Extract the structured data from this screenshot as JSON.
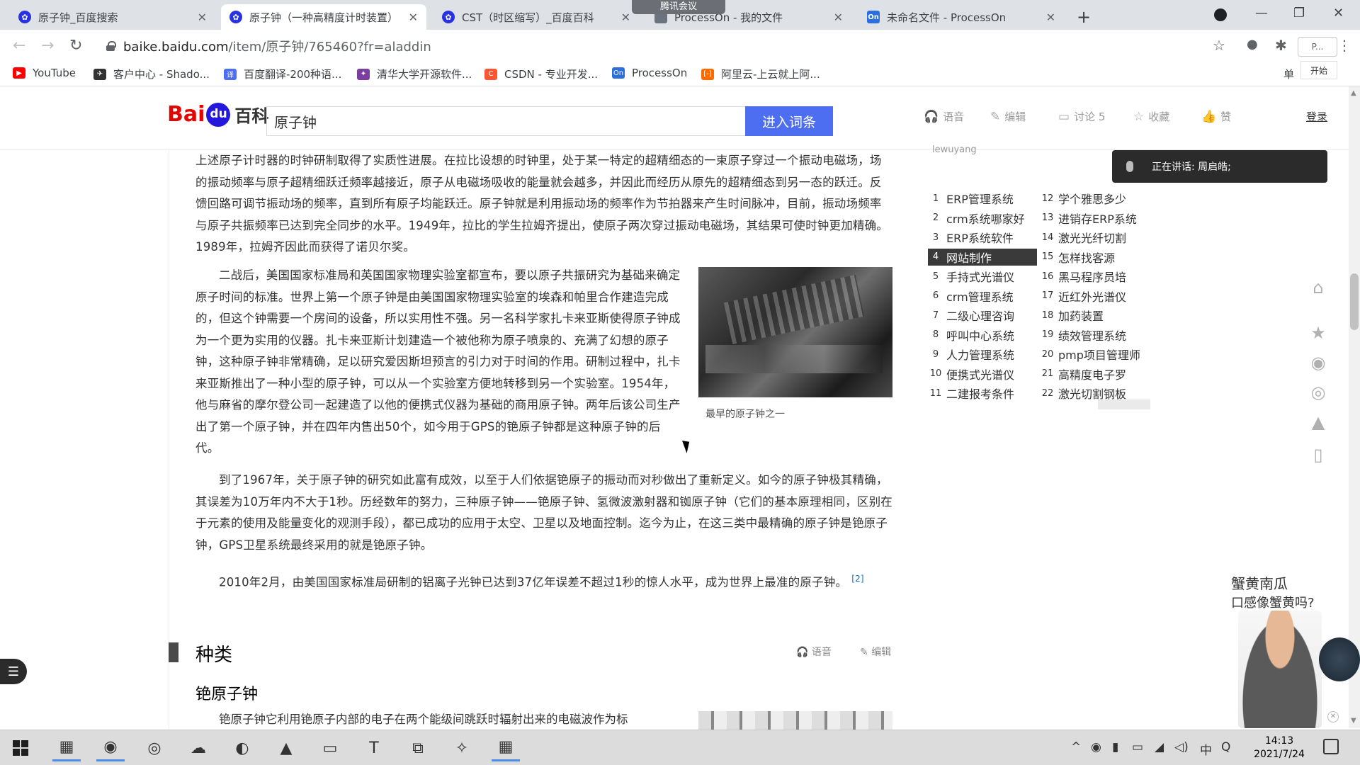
{
  "browser": {
    "tabs": [
      {
        "title": "原子钟_百度搜索",
        "icon": "paw"
      },
      {
        "title": "原子钟（一种高精度计时装置）",
        "icon": "paw"
      },
      {
        "title": "CST（时区缩写）_百度百科",
        "icon": "paw"
      },
      {
        "title": "ProcessOn - 我的文件",
        "icon": "doc"
      },
      {
        "title": "未命名文件 - ProcessOn",
        "icon": "on"
      }
    ],
    "meeting_pill": "腾讯会议",
    "url": {
      "host": "baike.baidu.com",
      "path": "/item/原子钟/765460?fr=aladdin"
    },
    "profile_chip": "P...",
    "kaishi": "开始",
    "bookmarks": [
      {
        "label": "YouTube",
        "color": "#ff0000"
      },
      {
        "label": "客户中心 - Shado...",
        "color": "#333333"
      },
      {
        "label": "百度翻译-200种语...",
        "color": "#4e6ef2"
      },
      {
        "label": "清华大学开源软件...",
        "color": "#7b3fa0"
      },
      {
        "label": "CSDN - 专业开发...",
        "color": "#fc5531"
      },
      {
        "label": "ProcessOn",
        "color": "#2a6fdb"
      },
      {
        "label": "阿里云-上云就上阿...",
        "color": "#ff6a00"
      }
    ],
    "readlist": "单"
  },
  "header": {
    "logo_bai": "Bai",
    "logo_baike": "百科",
    "search_value": "原子钟",
    "search_button": "进入词条",
    "actions": [
      {
        "icon": "headphone-icon",
        "glyph": "🎧",
        "label": "语音"
      },
      {
        "icon": "pencil-icon",
        "glyph": "✎",
        "label": "编辑"
      },
      {
        "icon": "comment-icon",
        "glyph": "▭",
        "label": "讨论 5"
      },
      {
        "icon": "star-icon",
        "glyph": "☆",
        "label": "收藏"
      },
      {
        "icon": "thumb-icon",
        "glyph": "👍",
        "label": "赞"
      }
    ],
    "login": "登录"
  },
  "article": {
    "p1": "上述原子计时器的时钟研制取得了实质性进展。在拉比设想的时钟里，处于某一特定的超精细态的一束原子穿过一个振动电磁场，场的振动频率与原子超精细跃迁频率越接近，原子从电磁场吸收的能量就会越多，并因此而经历从原先的超精细态到另一态的跃迁。反馈回路可调节振动场的频率，直到所有原子均能跃迁。原子钟就是利用振动场的频率作为节拍器来产生时间脉冲，目前，振动场频率与原子共振频率已达到完全同步的水平。1949年，拉比的学生拉姆齐提出，使原子两次穿过振动电磁场，其结果可使时钟更加精确。1989年，拉姆齐因此而获得了诺贝尔奖。",
    "p2": "二战后，美国国家标准局和英国国家物理实验室都宣布，要以原子共振研究为基础来确定原子时间的标准。世界上第一个原子钟是由美国国家物理实验室的埃森和帕里合作建造完成的，但这个钟需要一个房间的设备，所以实用性不强。另一名科学家扎卡来亚斯使得原子钟成为一个更为实用的仪器。扎卡来亚斯计划建造一个被他称为原子喷泉的、充满了幻想的原子钟，这种原子钟非常精确，足以研究爱因斯坦预言的引力对于时间的作用。研制过程中，扎卡来亚斯推出了一种小型的原子钟，可以从一个实验室方便地转移到另一个实验室。1954年，他与麻省的摩尔登公司一起建造了以他的便携式仪器为基础的商用原子钟。两年后该公司生产出了第一个原子钟，并在四年内售出50个，如今用于GPS的铯原子钟都是这种原子钟的后代。",
    "figure1_caption": "最早的原子钟之一",
    "p3": "到了1967年，关于原子钟的研究如此富有成效，以至于人们依据铯原子的振动而对秒做出了重新定义。如今的原子钟极其精确，其误差为10万年内不大于1秒。历经数年的努力，三种原子钟——铯原子钟、氢微波激射器和铷原子钟（它们的基本原理相同，区别在于元素的使用及能量变化的观测手段），都已成功的应用于太空、卫星以及地面控制。迄今为止，在这三类中最精确的原子钟是铯原子钟，GPS卫星系统最终采用的就是铯原子钟。",
    "p4": "2010年2月，由美国国家标准局研制的铝离子光钟已达到37亿年误差不超过1秒的惊人水平，成为世界上最准的原子钟。",
    "p4_ref": "[2]",
    "section_title": "种类",
    "section_actions": [
      "语音",
      "编辑"
    ],
    "subsection_title": "铯原子钟",
    "p5": "铯原子钟它利用铯原子内部的电子在两个能级间跳跃时辐射出来的电磁波作为标"
  },
  "sidebar": {
    "top_text": "lewuyang",
    "speaking": "正在讲话: 周启皓;",
    "rank_left": [
      {
        "n": "1",
        "t": "ERP管理系统"
      },
      {
        "n": "2",
        "t": "crm系统哪家好"
      },
      {
        "n": "3",
        "t": "ERP系统软件"
      },
      {
        "n": "4",
        "t": "网站制作"
      },
      {
        "n": "5",
        "t": "手持式光谱仪"
      },
      {
        "n": "6",
        "t": "crm管理系统"
      },
      {
        "n": "7",
        "t": "二级心理咨询"
      },
      {
        "n": "8",
        "t": "呼叫中心系统"
      },
      {
        "n": "9",
        "t": "人力管理系统"
      },
      {
        "n": "10",
        "t": "便携式光谱仪"
      },
      {
        "n": "11",
        "t": "二建报考条件"
      }
    ],
    "rank_right": [
      {
        "n": "12",
        "t": "学个雅思多少"
      },
      {
        "n": "13",
        "t": "进销存ERP系统"
      },
      {
        "n": "14",
        "t": "激光光纤切割"
      },
      {
        "n": "15",
        "t": "怎样找客源"
      },
      {
        "n": "16",
        "t": "黑马程序员培"
      },
      {
        "n": "17",
        "t": "近红外光谱仪"
      },
      {
        "n": "18",
        "t": "加药装置"
      },
      {
        "n": "19",
        "t": "绩效管理系统"
      },
      {
        "n": "20",
        "t": "pmp项目管理师"
      },
      {
        "n": "21",
        "t": "高精度电子罗"
      },
      {
        "n": "22",
        "t": "激光切割钢板"
      }
    ],
    "promo_line1": "蟹黄南瓜",
    "promo_line2": "口感像蟹黄吗?"
  },
  "taskbar": {
    "time": "14:13",
    "date": "2021/7/24",
    "ime": "中"
  }
}
